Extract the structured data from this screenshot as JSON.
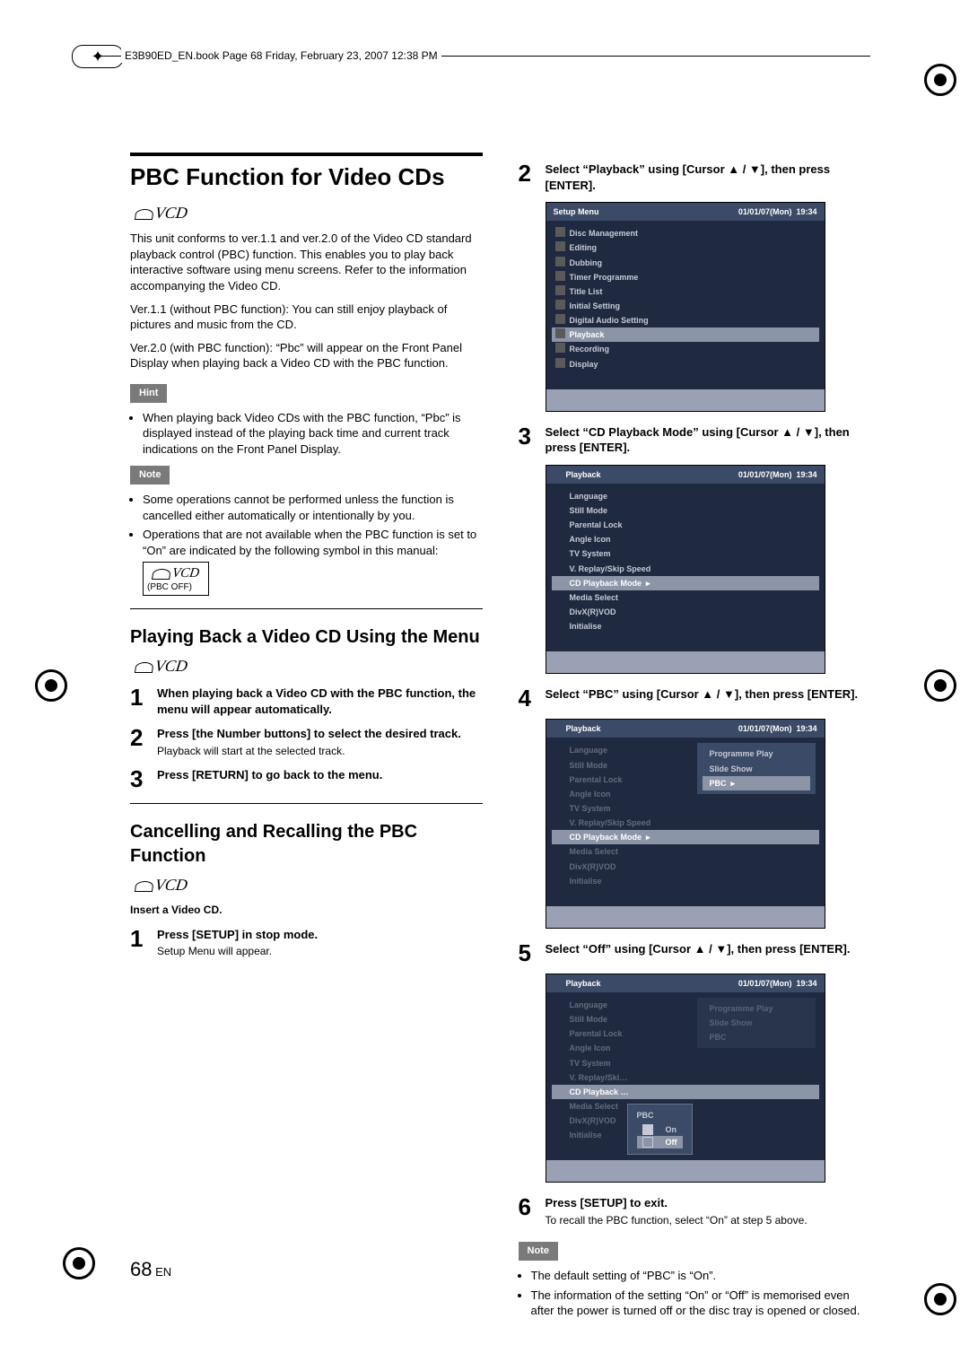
{
  "header": {
    "filepath": "E3B90ED_EN.book  Page 68  Friday, February 23, 2007  12:38 PM"
  },
  "page_number": "68",
  "page_lang": "EN",
  "left": {
    "title": "PBC Function for Video CDs",
    "vcd_label": "VCD",
    "intro": "This unit conforms to ver.1.1 and ver.2.0 of the Video CD standard playback control (PBC) function. This enables you to play back interactive software using menu screens. Refer to the information accompanying the Video CD.",
    "intro2": "Ver.1.1 (without PBC function): You can still enjoy playback of pictures and music from the CD.",
    "intro3": "Ver.2.0 (with PBC function): “Pbc” will appear on the Front Panel Display when playing back a Video CD with the PBC function.",
    "hint_label": "Hint",
    "hint1": "When playing back Video CDs with the PBC function, “Pbc” is displayed instead of the playing back time and current track indications on the Front Panel Display.",
    "note_label": "Note",
    "note1": "Some operations cannot be performed unless the function is cancelled either automatically or intentionally by you.",
    "note2": "Operations that are not available when the PBC function is set to “On” are indicated by the following symbol in this manual:",
    "pbc_off": "(PBC OFF)",
    "sec2_title": "Playing Back a Video CD Using the Menu",
    "s2_1": "When playing back a Video CD with the PBC function, the menu will appear automatically.",
    "s2_2": "Press [the Number buttons] to select the desired track.",
    "s2_2_sub": "Playback will start at the selected track.",
    "s2_3": "Press [RETURN] to go back to the menu.",
    "sec3_title": "Cancelling and Recalling the PBC Function",
    "s3_pre": "Insert a Video CD.",
    "s3_1": "Press [SETUP] in stop mode.",
    "s3_1_sub": "Setup Menu will appear."
  },
  "right": {
    "step2": "Select “Playback” using [Cursor ▲ / ▼], then press [ENTER].",
    "step3": "Select “CD Playback Mode” using [Cursor ▲ / ▼], then press [ENTER].",
    "step4": "Select “PBC” using [Cursor ▲ / ▼], then press [ENTER].",
    "step5": "Select “Off” using [Cursor ▲ / ▼], then press [ENTER].",
    "step6": "Press [SETUP] to exit.",
    "step6_sub": "To recall the PBC function, select “On” at step 5 above.",
    "note_label": "Note",
    "note1": "The default setting of “PBC” is “On”.",
    "note2": "The information of the setting “On” or “Off” is memorised even after the power is turned off or the disc tray is opened or closed."
  },
  "ss_date": "01/01/07(Mon)",
  "ss_time": "19:34",
  "menu1": {
    "title": "Setup Menu",
    "items": [
      "Disc Management",
      "Editing",
      "Dubbing",
      "Timer Programme",
      "Title List",
      "Initial Setting",
      "Digital Audio Setting",
      "Playback",
      "Recording",
      "Display"
    ]
  },
  "menu2": {
    "title": "Playback",
    "items": [
      "Language",
      "Still Mode",
      "Parental Lock",
      "Angle Icon",
      "TV System",
      "V. Replay/Skip Speed",
      "CD Playback Mode",
      "Media Select",
      "DivX(R)VOD",
      "Initialise"
    ]
  },
  "menu3_sub": [
    "Programme Play",
    "Slide Show",
    "PBC"
  ],
  "menu4_sub_title": "PBC",
  "menu4_on": "On",
  "menu4_off": "Off"
}
